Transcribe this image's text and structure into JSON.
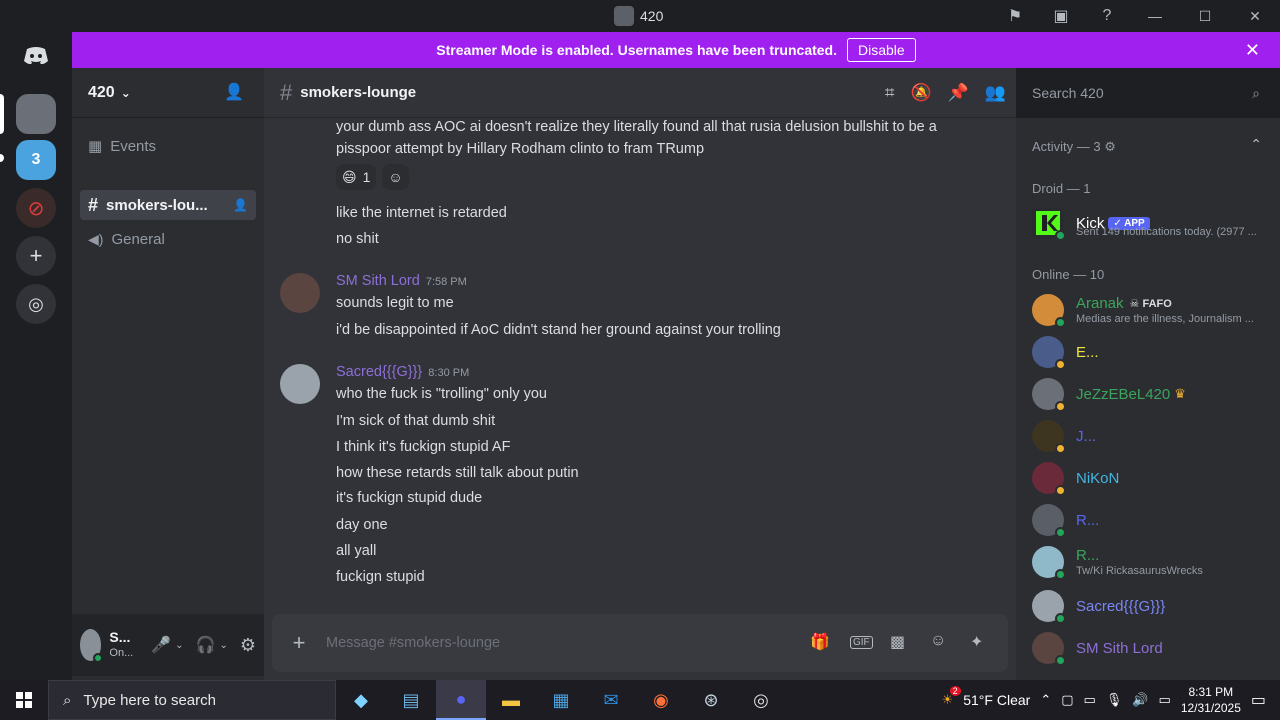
{
  "window": {
    "title": "420"
  },
  "banner": {
    "text": "Streamer Mode is enabled. Usernames have been truncated.",
    "button": "Disable"
  },
  "server": {
    "name": "420"
  },
  "sidebar": {
    "events_label": "Events",
    "channels": [
      {
        "name": "smokers-lou...",
        "type": "text",
        "active": true
      },
      {
        "name": "General",
        "type": "voice",
        "active": false
      }
    ]
  },
  "user_panel": {
    "name": "S...",
    "status": "On..."
  },
  "channel": {
    "name": "smokers-lounge"
  },
  "search": {
    "placeholder": "Search 420"
  },
  "messages": {
    "continued": [
      "your dumb ass AOC ai doesn't realize they literally found all that rusia delusion bullshit to be a",
      "pisspoor attempt by Hillary Rodham clinto to fram TRump"
    ],
    "reaction_count": "1",
    "continued2": [
      "like the internet is retarded",
      "no shit"
    ],
    "groups": [
      {
        "author": "SM Sith Lord",
        "time": "7:58 PM",
        "color": "#8e6fd8",
        "lines": [
          "sounds legit to me",
          "i'd be disappointed if AoC didn't stand her ground against your trolling"
        ]
      },
      {
        "author": "Sacred{{{G}}}",
        "time": "8:30 PM",
        "color": "#8e6fd8",
        "lines": [
          "who the fuck is \"trolling\" only you",
          "I'm sick of that dumb shit",
          "I think it's fuckign stupid AF",
          "how these retards still talk about putin",
          "it's fuckign stupid dude",
          "day one",
          "all yall",
          "fuckign stupid"
        ]
      }
    ]
  },
  "composer": {
    "placeholder": "Message #smokers-lounge"
  },
  "members": {
    "activity": "Activity — 3",
    "droid_header": "Droid — 1",
    "online_header": "Online — 10",
    "droid": [
      {
        "name": "Kick",
        "badge": "✓ APP",
        "status": "Sent 149 notifications today. (2977 ...",
        "color": "#ffffff"
      }
    ],
    "online": [
      {
        "name": "Aranak",
        "tag": "FAFO",
        "status": "Medias are the illness, Journalism ...",
        "color": "#3ba55d"
      },
      {
        "name": "E...",
        "status": "",
        "color": "#f0e442"
      },
      {
        "name": "JeZzEBeL420",
        "status": "",
        "color": "#3ba55d"
      },
      {
        "name": "J...",
        "status": "",
        "color": "#5865f2"
      },
      {
        "name": "NiKoN",
        "status": "",
        "color": "#44b4e0"
      },
      {
        "name": "R...",
        "status": "",
        "color": "#5865f2"
      },
      {
        "name": "R...",
        "status": "Tw/Ki RickasaurusWrecks",
        "color": "#3ba55d"
      },
      {
        "name": "Sacred{{{G}}}",
        "status": "",
        "color": "#7b86f5"
      },
      {
        "name": "SM Sith Lord",
        "status": "",
        "color": "#8e6fd8"
      }
    ]
  },
  "taskbar": {
    "search_placeholder": "Type here to search",
    "weather": "51°F  Clear",
    "weather_badge": "2",
    "time": "8:31 PM",
    "date": "12/31/2025"
  }
}
